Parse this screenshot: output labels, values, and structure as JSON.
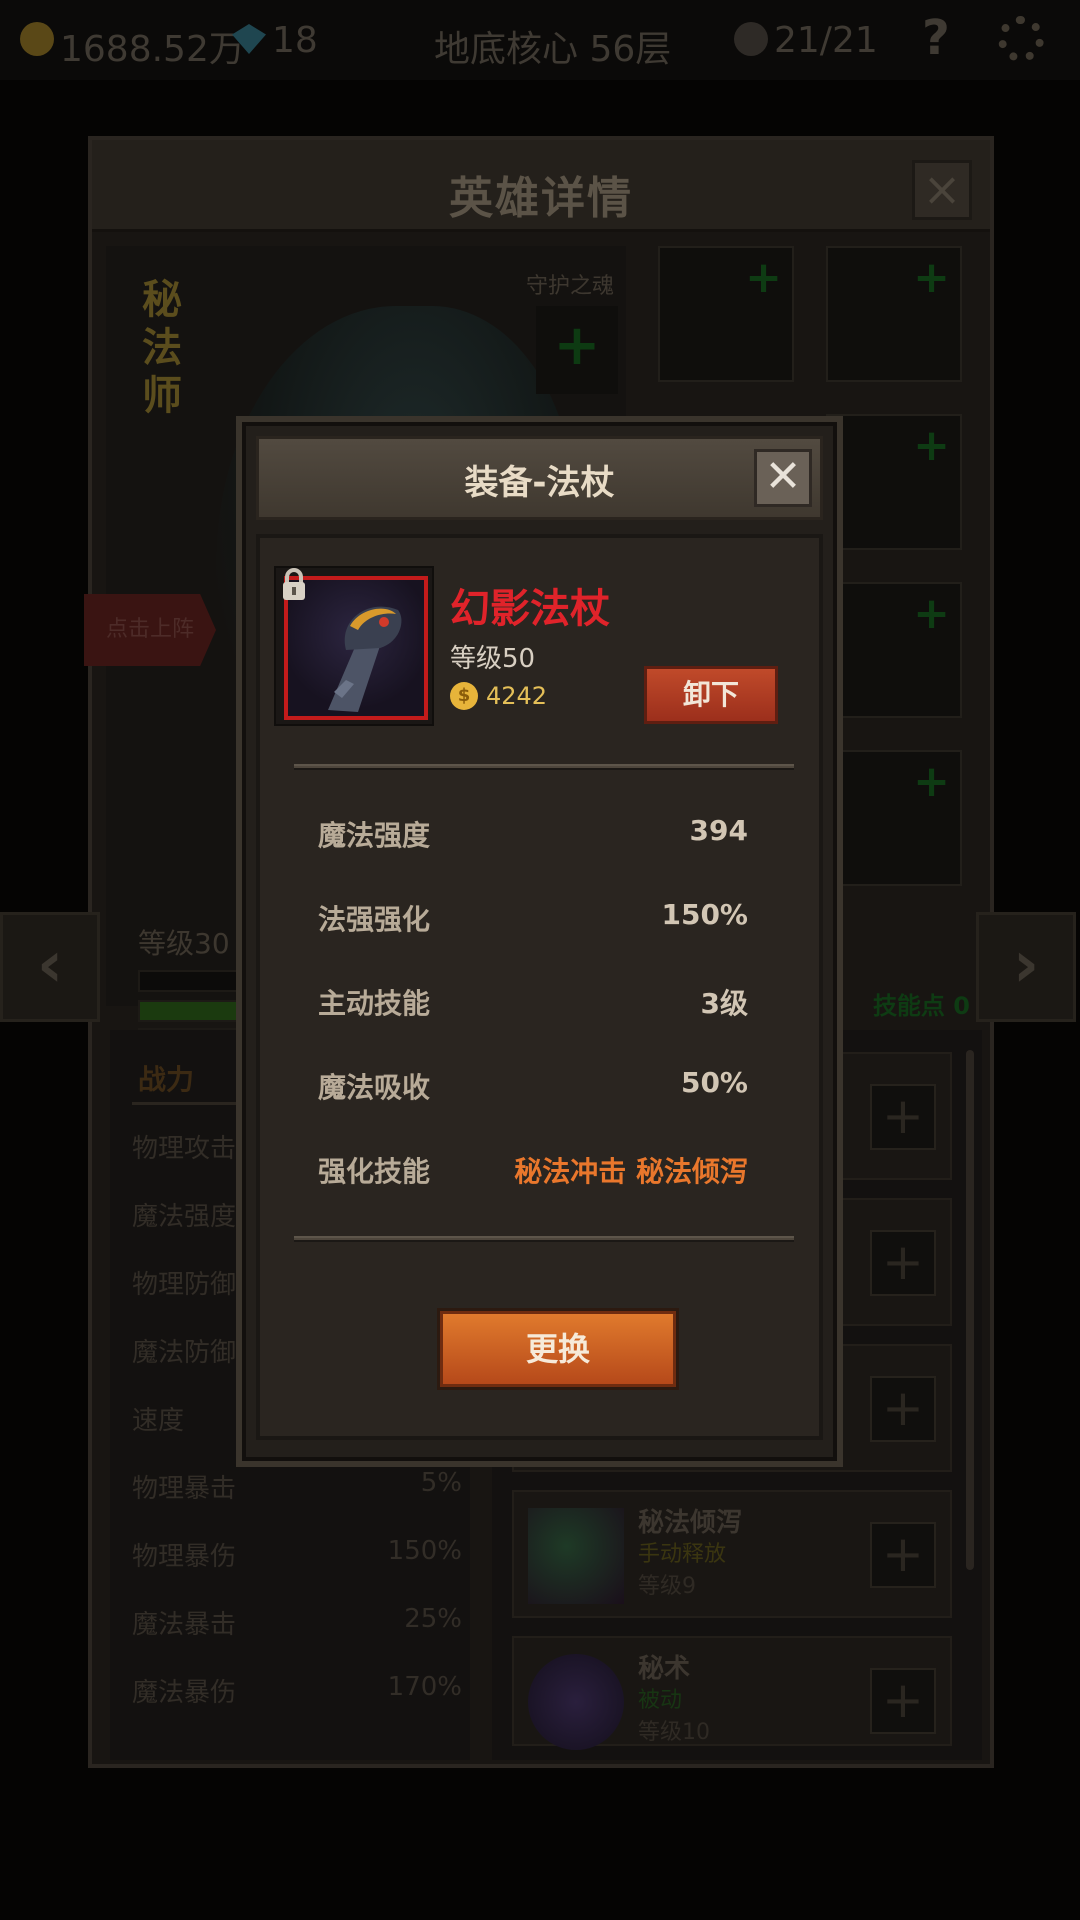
{
  "topbar": {
    "gold": "1688.52万",
    "gems": "18",
    "location": "地底核心 56层",
    "skulls": "21/21",
    "help": "?"
  },
  "hero_window": {
    "title": "英雄详情",
    "hero_name": "秘\n法\n师",
    "guard_label": "守护之魂",
    "deploy_label": "点击上阵",
    "level_label": "等级30",
    "skill_points": "技能点 0",
    "stats_title": "战力",
    "stats": [
      {
        "label": "物理攻击",
        "value": ""
      },
      {
        "label": "魔法强度",
        "value": ""
      },
      {
        "label": "物理防御",
        "value": ""
      },
      {
        "label": "魔法防御",
        "value": ""
      },
      {
        "label": "速度",
        "value": ""
      },
      {
        "label": "物理暴击",
        "value": "5%"
      },
      {
        "label": "物理暴伤",
        "value": "150%"
      },
      {
        "label": "魔法暴击",
        "value": "25%"
      },
      {
        "label": "魔法暴伤",
        "value": "170%"
      }
    ],
    "skills": [
      {
        "name": "秘法倾泻",
        "type": "手动释放",
        "level": "等级9"
      },
      {
        "name": "秘术",
        "type": "被动",
        "level": "等级10"
      }
    ]
  },
  "modal": {
    "title": "装备-法杖",
    "item_name": "幻影法杖",
    "item_level": "等级50",
    "gold_symbol": "$",
    "gold_value": "4242",
    "unequip_label": "卸下",
    "attributes": [
      {
        "label": "魔法强度",
        "value": "394"
      },
      {
        "label": "法强强化",
        "value": "150%"
      },
      {
        "label": "主动技能",
        "value": "3级"
      },
      {
        "label": "魔法吸收",
        "value": "50%"
      },
      {
        "label": "强化技能",
        "value": "秘法冲击 秘法倾泻"
      }
    ],
    "change_label": "更换"
  },
  "colors": {
    "item_name": "#e0232a",
    "highlight_orange": "#e9772c",
    "item_frame": "#c31b1b",
    "gold": "#e4bf58"
  }
}
